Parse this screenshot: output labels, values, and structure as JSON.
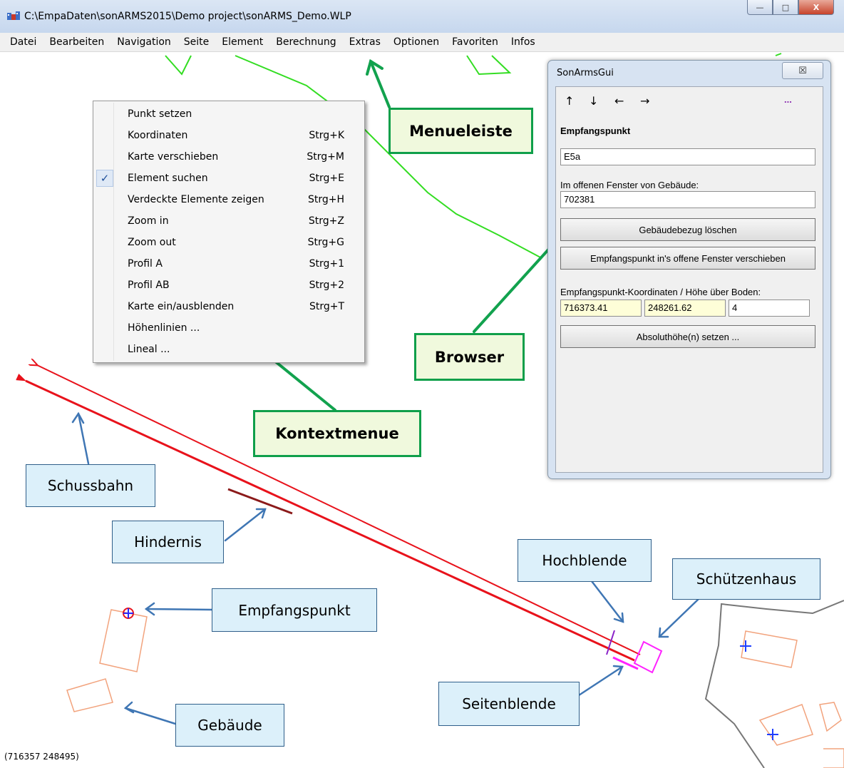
{
  "window": {
    "title": "C:\\EmpaDaten\\sonARMS2015\\Demo project\\sonARMS_Demo.WLP",
    "min_label": "—",
    "max_label": "□",
    "close_label": "X"
  },
  "menubar": {
    "items": [
      "Datei",
      "Bearbeiten",
      "Navigation",
      "Seite",
      "Element",
      "Berechnung",
      "Extras",
      "Optionen",
      "Favoriten",
      "Infos"
    ]
  },
  "context_menu": {
    "items": [
      {
        "label": "Punkt setzen",
        "shortcut": "",
        "checked": false
      },
      {
        "label": "Koordinaten",
        "shortcut": "Strg+K",
        "checked": false
      },
      {
        "label": "Karte verschieben",
        "shortcut": "Strg+M",
        "checked": false
      },
      {
        "label": "Element suchen",
        "shortcut": "Strg+E",
        "checked": true
      },
      {
        "label": "Verdeckte Elemente zeigen",
        "shortcut": "Strg+H",
        "checked": false
      },
      {
        "label": "Zoom in",
        "shortcut": "Strg+Z",
        "checked": false
      },
      {
        "label": "Zoom out",
        "shortcut": "Strg+G",
        "checked": false
      },
      {
        "label": "Profil A",
        "shortcut": "Strg+1",
        "checked": false
      },
      {
        "label": "Profil AB",
        "shortcut": "Strg+2",
        "checked": false
      },
      {
        "label": "Karte ein/ausblenden",
        "shortcut": "Strg+T",
        "checked": false
      },
      {
        "label": "Höhenlinien ...",
        "shortcut": "",
        "checked": false
      },
      {
        "label": "Lineal ...",
        "shortcut": "",
        "checked": false
      }
    ],
    "check_glyph": "✓"
  },
  "panel": {
    "title": "SonArmsGui",
    "close_glyph": "☒",
    "nav_up": "↑",
    "nav_down": "↓",
    "nav_left": "←",
    "nav_right": "→",
    "more": "...",
    "heading": "Empfangspunkt",
    "point_name": "E5a",
    "building_label": "Im offenen Fenster von Gebäude:",
    "building_id": "702381",
    "btn_delete_building_ref": "Gebäudebezug löschen",
    "btn_move_to_window": "Empfangspunkt in's offene Fenster verschieben",
    "coords_label": "Empfangspunkt-Koordinaten / Höhe über Boden:",
    "coord_x": "716373.41",
    "coord_y": "248261.62",
    "height": "4",
    "btn_absolute_height": "Absoluthöhe(n) setzen ..."
  },
  "status": {
    "coords": "(716357   248495)"
  },
  "callouts": {
    "menueleiste": "Menueleiste",
    "browser": "Browser",
    "kontextmenue": "Kontextmenue",
    "schussbahn": "Schussbahn",
    "hindernis": "Hindernis",
    "hochblende": "Hochblende",
    "schuetzenhaus": "Schützenhaus",
    "empfangspunkt": "Empfangspunkt",
    "seitenblende": "Seitenblende",
    "gebaeude": "Gebäude"
  },
  "colors": {
    "green_arrow": "#12a24e",
    "blue_arrow": "#3f76b4",
    "shot_line": "#e8121b",
    "obstacle": "#8b1a1a",
    "building": "#f2a37d",
    "contour": "#33dd22",
    "shooter_house": "#ff22ff",
    "high_baffle": "#8a22c8",
    "boundary": "#777777",
    "marker": "#1f3fff"
  }
}
